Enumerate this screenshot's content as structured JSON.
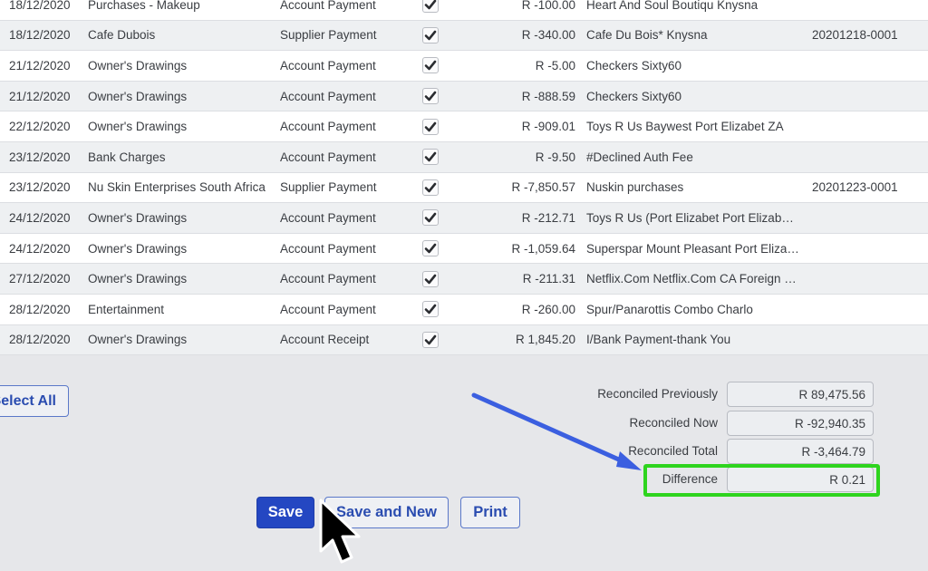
{
  "transactions": [
    {
      "date": "18/12/2020",
      "description": "Purchases - Makeup",
      "type": "Account Payment",
      "reconciled": true,
      "amount": "R -100.00",
      "reference": "Heart And Soul Boutiqu Knysna",
      "doc_number": ""
    },
    {
      "date": "18/12/2020",
      "description": "Cafe Dubois",
      "type": "Supplier Payment",
      "reconciled": true,
      "amount": "R -340.00",
      "reference": "Cafe Du Bois* Knysna",
      "doc_number": "20201218-0001"
    },
    {
      "date": "21/12/2020",
      "description": "Owner's Drawings",
      "type": "Account Payment",
      "reconciled": true,
      "amount": "R -5.00",
      "reference": "Checkers Sixty60",
      "doc_number": ""
    },
    {
      "date": "21/12/2020",
      "description": "Owner's Drawings",
      "type": "Account Payment",
      "reconciled": true,
      "amount": "R -888.59",
      "reference": "Checkers Sixty60",
      "doc_number": ""
    },
    {
      "date": "22/12/2020",
      "description": "Owner's Drawings",
      "type": "Account Payment",
      "reconciled": true,
      "amount": "R -909.01",
      "reference": "Toys R Us Baywest Port Elizabet ZA",
      "doc_number": ""
    },
    {
      "date": "23/12/2020",
      "description": "Bank Charges",
      "type": "Account Payment",
      "reconciled": true,
      "amount": "R -9.50",
      "reference": "#Declined Auth Fee",
      "doc_number": ""
    },
    {
      "date": "23/12/2020",
      "description": "Nu Skin Enterprises South Africa",
      "type": "Supplier Payment",
      "reconciled": true,
      "amount": "R -7,850.57",
      "reference": "Nuskin purchases",
      "doc_number": "20201223-0001"
    },
    {
      "date": "24/12/2020",
      "description": "Owner's Drawings",
      "type": "Account Payment",
      "reconciled": true,
      "amount": "R -212.71",
      "reference": "Toys R Us (Port Elizabet Port Elizabet …",
      "doc_number": ""
    },
    {
      "date": "24/12/2020",
      "description": "Owner's Drawings",
      "type": "Account Payment",
      "reconciled": true,
      "amount": "R -1,059.64",
      "reference": "Superspar Mount Pleasant Port Eliza…",
      "doc_number": ""
    },
    {
      "date": "27/12/2020",
      "description": "Owner's Drawings",
      "type": "Account Payment",
      "reconciled": true,
      "amount": "R -211.31",
      "reference": "Netflix.Com Netflix.Com CA Foreign …",
      "doc_number": ""
    },
    {
      "date": "28/12/2020",
      "description": "Entertainment",
      "type": "Account Payment",
      "reconciled": true,
      "amount": "R -260.00",
      "reference": "Spur/Panarottis Combo Charlo",
      "doc_number": ""
    },
    {
      "date": "28/12/2020",
      "description": "Owner's Drawings",
      "type": "Account Receipt",
      "reconciled": true,
      "amount": "R 1,845.20",
      "reference": "I/Bank Payment-thank You",
      "doc_number": ""
    }
  ],
  "select_all_label": "Select All",
  "totals": {
    "reconciled_previously": {
      "label": "Reconciled Previously",
      "value": "R 89,475.56"
    },
    "reconciled_now": {
      "label": "Reconciled Now",
      "value": "R -92,940.35"
    },
    "reconciled_total": {
      "label": "Reconciled Total",
      "value": "R -3,464.79"
    },
    "difference": {
      "label": "Difference",
      "value": "R 0.21"
    }
  },
  "actions": {
    "save": "Save",
    "save_and_new": "Save and New",
    "print": "Print"
  },
  "colors": {
    "primary": "#2447c2",
    "annotation_arrow": "#3b5fe0",
    "highlight_box": "#2ed41e"
  }
}
